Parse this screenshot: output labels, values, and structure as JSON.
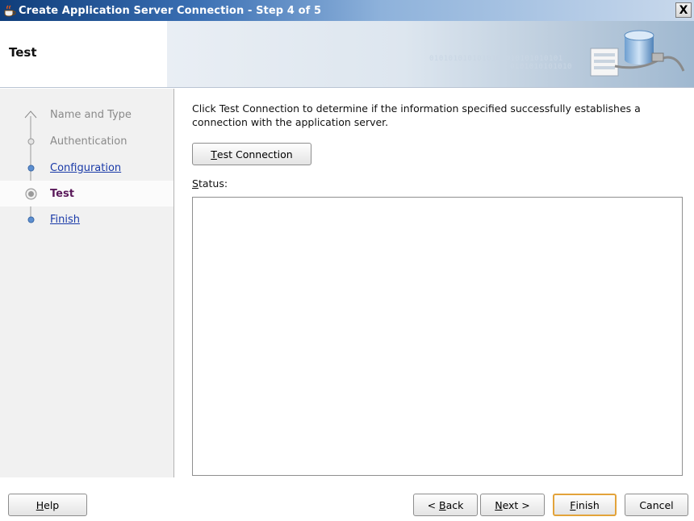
{
  "window": {
    "title": "Create Application Server Connection - Step 4 of 5",
    "close_glyph": "X",
    "app_icon": "java-cup-icon"
  },
  "header": {
    "page_title": "Test",
    "binary_text_1": "0101010101010101010101010101",
    "binary_text_2": "0101010101010",
    "graphic_icon": "database-connection-icon"
  },
  "steps": [
    {
      "label": "Name and Type",
      "state": "disabled"
    },
    {
      "label": "Authentication",
      "state": "disabled"
    },
    {
      "label": "Configuration",
      "state": "link"
    },
    {
      "label": "Test",
      "state": "current"
    },
    {
      "label": "Finish",
      "state": "link"
    }
  ],
  "main": {
    "instructions": "Click Test Connection to determine if the information specified successfully establishes a connection with the application server.",
    "test_button": {
      "mnemonic": "T",
      "rest": "est Connection"
    },
    "status_label": {
      "mnemonic": "S",
      "rest": "tatus:"
    },
    "status_value": ""
  },
  "footer": {
    "help": {
      "mnemonic": "H",
      "rest": "elp"
    },
    "back": {
      "prefix": "< ",
      "mnemonic": "B",
      "rest": "ack"
    },
    "next": {
      "mnemonic": "N",
      "rest": "ext >"
    },
    "finish": {
      "mnemonic": "F",
      "rest": "inish"
    },
    "cancel": "Cancel"
  },
  "colors": {
    "current_step": "#5a1a5a",
    "link": "#1a3aa8",
    "default_button_border": "#e3a33a",
    "title_bar": "#0f3d7a"
  }
}
